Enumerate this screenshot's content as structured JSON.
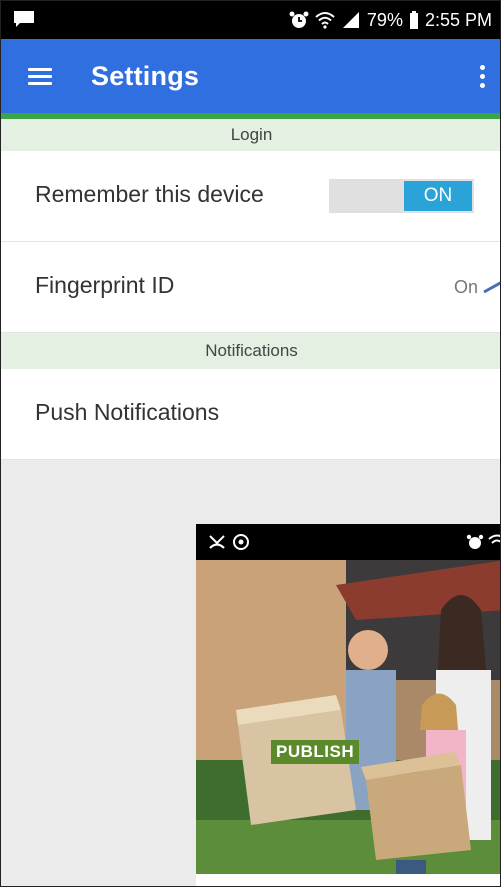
{
  "status_bar": {
    "battery": "79%",
    "time": "2:55 PM"
  },
  "app_bar": {
    "title": "Settings"
  },
  "sections": {
    "login": {
      "header": "Login",
      "remember_device_label": "Remember this device",
      "remember_device_toggle": "ON",
      "fingerprint_label": "Fingerprint ID",
      "fingerprint_value": "On"
    },
    "notifications": {
      "header": "Notifications",
      "push_label": "Push Notifications"
    }
  },
  "overlay": {
    "badge": "PUBLISH"
  },
  "colors": {
    "app_bar": "#2f6fe0",
    "accent_green": "#3aa645",
    "toggle_on": "#2aa3d8",
    "section_header_bg": "#e3f0e2"
  }
}
